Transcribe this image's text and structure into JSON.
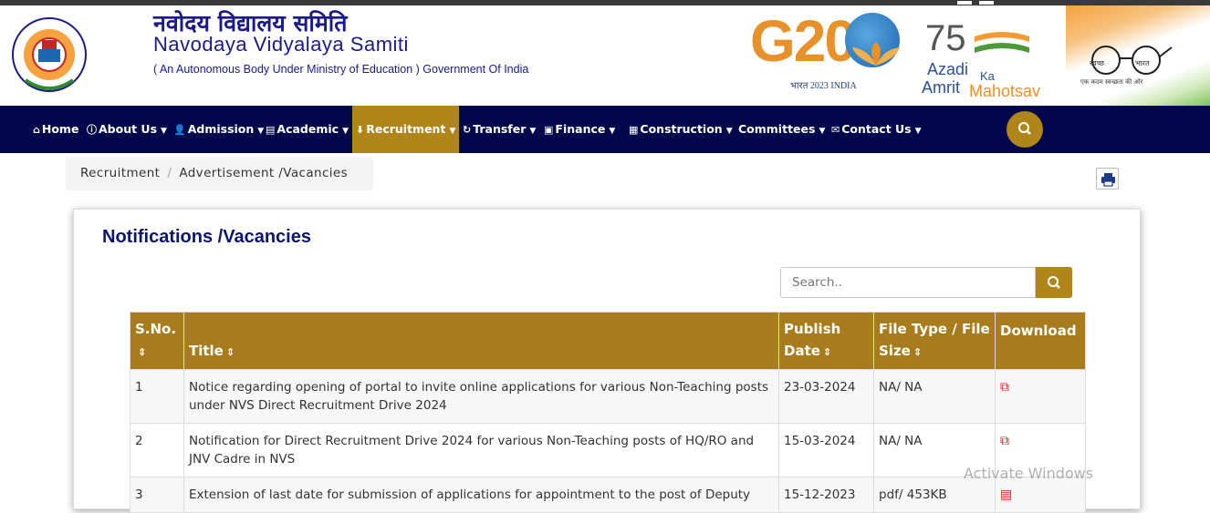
{
  "header": {
    "title_hindi": "नवोदय विद्यालय समिति",
    "title_english": "Navodaya Vidyalaya Samiti",
    "subtitle": "( An Autonomous Body Under Ministry of Education ) Government Of India",
    "g20": {
      "text": "G20",
      "sub": "भारत 2023 INDIA"
    },
    "aka": {
      "number": "75",
      "line1": "Azadi",
      "ka": "Ka",
      "line2a": "Amrit",
      "line2b": "Mahotsav"
    },
    "swachh": {
      "left": "स्वच्छ",
      "right": "भारत",
      "tagline": "एक कदम स्वच्छता की ओर"
    }
  },
  "nav": {
    "items": [
      {
        "label": "Home",
        "icon": "home-icon"
      },
      {
        "label": "About Us",
        "icon": "info-icon"
      },
      {
        "label": "Admission",
        "icon": "user-icon"
      },
      {
        "label": "Academic",
        "icon": "book-icon"
      },
      {
        "label": "Recruitment",
        "icon": "download-icon"
      },
      {
        "label": "Transfer",
        "icon": "refresh-icon"
      },
      {
        "label": "Finance",
        "icon": "money-icon"
      },
      {
        "label": "Construction",
        "icon": "building-icon"
      },
      {
        "label": "Committees",
        "icon": ""
      },
      {
        "label": "Contact Us",
        "icon": "envelope-icon"
      }
    ],
    "active": "Recruitment"
  },
  "breadcrumb": {
    "items": [
      "Recruitment",
      "Advertisement /Vacancies"
    ]
  },
  "panel": {
    "title": "Notifications /Vacancies",
    "search_placeholder": "Search.."
  },
  "table": {
    "headers": [
      "S.No.",
      "Title",
      "Publish Date",
      "File Type / File Size",
      "Download"
    ],
    "rows": [
      {
        "sno": "1",
        "title": "Notice regarding opening of portal to invite online applications for various Non-Teaching posts under NVS Direct Recruitment Drive 2024",
        "date": "23-03-2024",
        "file": "NA/ NA"
      },
      {
        "sno": "2",
        "title": "Notification for Direct Recruitment Drive 2024 for various Non-Teaching posts of HQ/RO and JNV Cadre in NVS",
        "date": "15-03-2024",
        "file": "NA/ NA"
      },
      {
        "sno": "3",
        "title": "Extension of last date for submission of applications for appointment to the post of Deputy",
        "date": "15-12-2023",
        "file": "pdf/ 453KB"
      }
    ]
  },
  "colors": {
    "navy": "#02064a",
    "gold": "#b0861b",
    "header_gold": "#a87c1c",
    "title_blue": "#0b1572"
  },
  "watermark": "Activate Windows"
}
